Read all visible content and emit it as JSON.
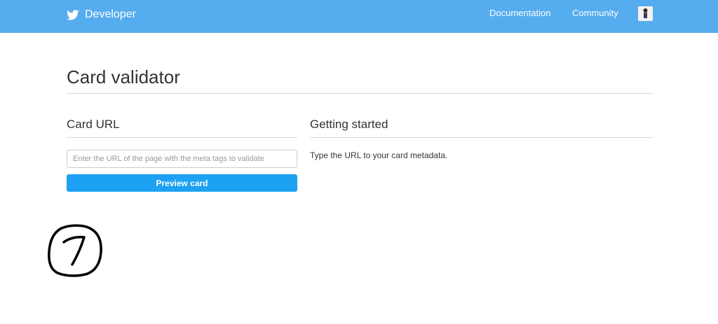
{
  "header": {
    "brand": "Developer",
    "nav": [
      {
        "label": "Documentation"
      },
      {
        "label": "Community"
      }
    ],
    "background_color": "#55acee"
  },
  "page": {
    "title": "Card validator"
  },
  "card_url": {
    "heading": "Card URL",
    "input_placeholder": "Enter the URL of the page with the meta tags to validate",
    "input_value": "",
    "button_label": "Preview card",
    "button_color": "#1da1f2"
  },
  "getting_started": {
    "heading": "Getting started",
    "text": "Type the URL to your card metadata."
  },
  "annotation": {
    "label": "7"
  }
}
